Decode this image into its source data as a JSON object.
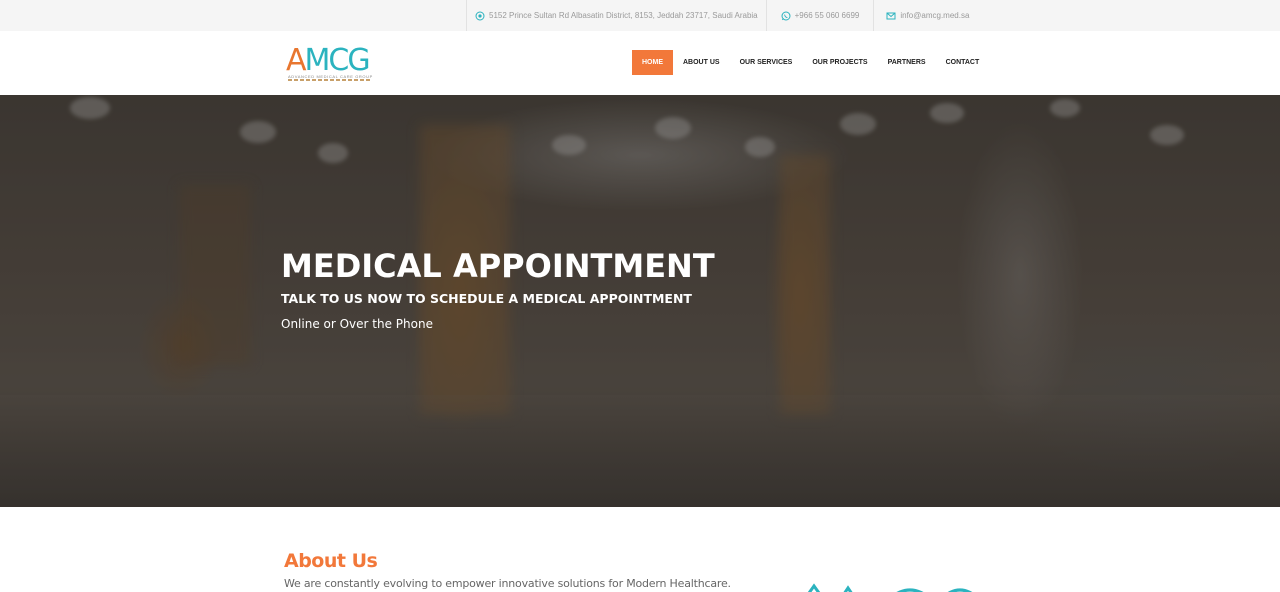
{
  "topbar": {
    "address": "5152 Prince Sultan Rd Albasatin District, 8153, Jeddah 23717, Saudi Arabia",
    "phone": "+966 55 060 6699",
    "email": "info@amcg.med.sa",
    "icons": [
      "location-icon",
      "whatsapp-icon",
      "email-icon"
    ]
  },
  "logo": {
    "word": "AMCG",
    "tagline": "ADVANCED MEDICAL CARE GROUP"
  },
  "nav": {
    "items": [
      "HOME",
      "ABOUT US",
      "OUR SERVICES",
      "OUR PROJECTS",
      "PARTNERS",
      "CONTACT"
    ],
    "active": "HOME"
  },
  "hero": {
    "title": "MEDICAL APPOINTMENT",
    "subtitle": "TALK TO US NOW TO SCHEDULE A MEDICAL APPOINTMENT",
    "text": "Online or Over the Phone"
  },
  "about": {
    "title": "About Us",
    "text": "We are constantly evolving to empower innovative solutions for Modern Healthcare."
  },
  "colors": {
    "accent": "#f2783a",
    "brand_teal": "#2bb3bf",
    "topbar_bg": "#f5f5f5"
  }
}
